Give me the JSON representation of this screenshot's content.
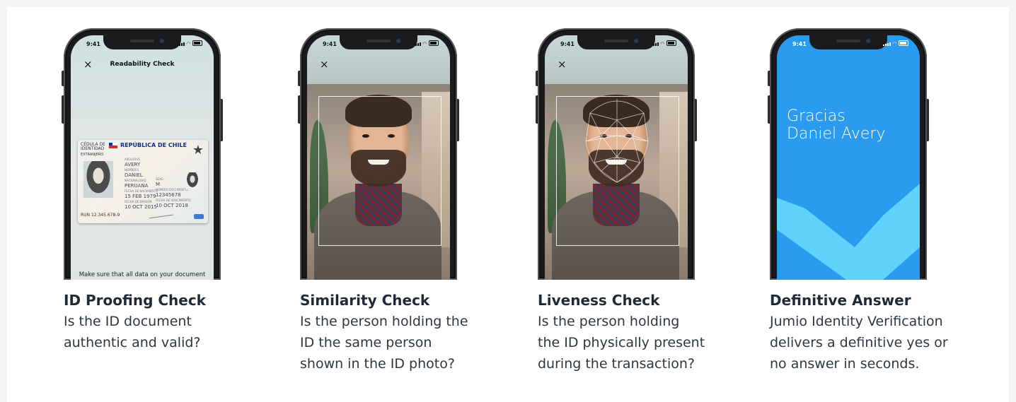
{
  "items": [
    {
      "title": "ID Proofing Check",
      "description": "Is the ID document\nauthentic and valid?",
      "screen": {
        "time": "9:41",
        "header": "Readability Check",
        "close": "×",
        "bottom_text": "Make sure that all data on your document",
        "id_card": {
          "doc_type": "CÉDULA DE IDENTIDAD",
          "country": "REPÚBLICA DE CHILE",
          "category": "EXTRANJERO",
          "surname_label": "APELLIDOS",
          "surname": "AVERY",
          "name_label": "NOMBRES",
          "name": "DANIEL",
          "nationality_label": "NACIONALIDAD",
          "nationality": "PERUANA",
          "sex_label": "SEXO",
          "sex": "M",
          "birth_label": "FECHA DE NACIMIENTO",
          "birth": "15 FEB 1979",
          "doc_number_label": "NÚMERO DOCUMENTO",
          "doc_number": "12345678",
          "issue_label": "FECHA DE EMISIÓN",
          "issue": "10 OCT 2015",
          "expiry_label": "FECHA DE VENCIMIENTO",
          "expiry": "10 OCT 2018",
          "run": "RUN 12.345.678-9"
        }
      }
    },
    {
      "title": "Similarity Check",
      "description": "Is the person holding the\nID the same person\nshown in the ID photo?",
      "screen": {
        "time": "9:41",
        "close": "×"
      }
    },
    {
      "title": "Liveness Check",
      "description": "Is the person holding\nthe ID physically present\nduring the transaction?",
      "screen": {
        "time": "9:41",
        "close": "×"
      }
    },
    {
      "title": "Definitive Answer",
      "description": "Jumio Identity Verification\ndelivers a definitive yes or\nno answer in seconds.",
      "screen": {
        "time": "9:41",
        "message": "Gracias\nDaniel Avery"
      }
    }
  ],
  "colors": {
    "title": "#1f2a37",
    "description": "#2f3640",
    "success_blue": "#2b9bf0",
    "check_light": "#5fd3fb"
  },
  "icons": [
    "close-icon",
    "signal-icon",
    "wifi-icon",
    "battery-icon",
    "checkmark-icon"
  ]
}
